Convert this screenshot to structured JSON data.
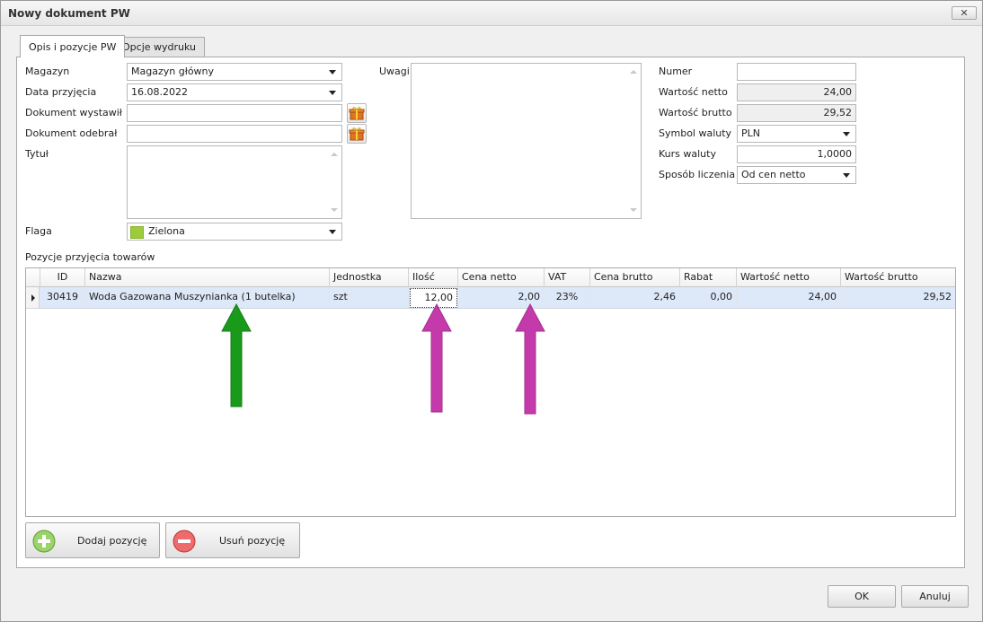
{
  "window": {
    "title": "Nowy dokument PW",
    "close": "✕"
  },
  "tabs": [
    "Opis i pozycje PW",
    "Opcje wydruku"
  ],
  "form": {
    "magazyn_label": "Magazyn",
    "magazyn_value": "Magazyn główny",
    "data_label": "Data przyjęcia",
    "data_value": "16.08.2022",
    "wystawil_label": "Dokument wystawił",
    "wystawil_value": "",
    "odebral_label": "Dokument odebrał",
    "odebral_value": "",
    "tytul_label": "Tytuł",
    "tytul_value": "",
    "flaga_label": "Flaga",
    "flaga_value": "Zielona",
    "flaga_color": "#9ecb3c",
    "uwagi_label": "Uwagi",
    "uwagi_value": ""
  },
  "summary": {
    "numer_label": "Numer",
    "numer_value": "",
    "netto_label": "Wartość netto",
    "netto_value": "24,00",
    "brutto_label": "Wartość brutto",
    "brutto_value": "29,52",
    "waluta_label": "Symbol waluty",
    "waluta_value": "PLN",
    "kurs_label": "Kurs waluty",
    "kurs_value": "1,0000",
    "sposob_label": "Sposób liczenia",
    "sposob_value": "Od cen netto"
  },
  "grid": {
    "caption": "Pozycje przyjęcia towarów",
    "columns": [
      "ID",
      "Nazwa",
      "Jednostka",
      "Ilość",
      "Cena netto",
      "VAT",
      "Cena brutto",
      "Rabat",
      "Wartość netto",
      "Wartość brutto"
    ],
    "rows": [
      [
        "30419",
        "Woda Gazowana Muszynianka (1 butelka)",
        "szt",
        "12,00",
        "2,00",
        "23%",
        "2,46",
        "0,00",
        "24,00",
        "29,52"
      ]
    ]
  },
  "buttons": {
    "add": "Dodaj pozycję",
    "remove": "Usuń pozycję",
    "ok": "OK",
    "cancel": "Anuluj"
  },
  "annotation_colors": {
    "green": "#1a9a1a",
    "magenta": "#c53aaa"
  }
}
